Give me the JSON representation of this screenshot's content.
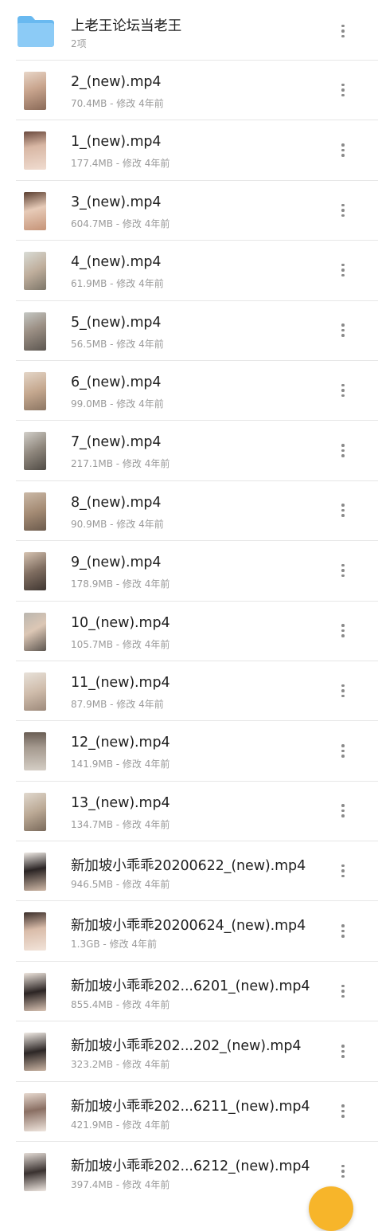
{
  "folder": {
    "name": "上老王论坛当老王",
    "count": "2项",
    "icon": "folder-icon",
    "color": "#5db4f2"
  },
  "files": [
    {
      "name": "2_(new).mp4",
      "meta": "70.4MB - 修改 4年前"
    },
    {
      "name": "1_(new).mp4",
      "meta": "177.4MB - 修改 4年前"
    },
    {
      "name": "3_(new).mp4",
      "meta": "604.7MB - 修改 4年前"
    },
    {
      "name": "4_(new).mp4",
      "meta": "61.9MB - 修改 4年前"
    },
    {
      "name": "5_(new).mp4",
      "meta": "56.5MB - 修改 4年前"
    },
    {
      "name": "6_(new).mp4",
      "meta": "99.0MB - 修改 4年前"
    },
    {
      "name": "7_(new).mp4",
      "meta": "217.1MB - 修改 4年前"
    },
    {
      "name": "8_(new).mp4",
      "meta": "90.9MB - 修改 4年前"
    },
    {
      "name": "9_(new).mp4",
      "meta": "178.9MB - 修改 4年前"
    },
    {
      "name": "10_(new).mp4",
      "meta": "105.7MB - 修改 4年前"
    },
    {
      "name": "11_(new).mp4",
      "meta": "87.9MB - 修改 4年前"
    },
    {
      "name": "12_(new).mp4",
      "meta": "141.9MB - 修改 4年前"
    },
    {
      "name": "13_(new).mp4",
      "meta": "134.7MB - 修改 4年前"
    },
    {
      "name": "新加坡小乖乖20200622_(new).mp4",
      "meta": "946.5MB - 修改 4年前"
    },
    {
      "name": "新加坡小乖乖20200624_(new).mp4",
      "meta": "1.3GB - 修改 4年前"
    },
    {
      "name": "新加坡小乖乖202...6201_(new).mp4",
      "meta": "855.4MB - 修改 4年前"
    },
    {
      "name": "新加坡小乖乖202...202_(new).mp4",
      "meta": "323.2MB - 修改 4年前"
    },
    {
      "name": "新加坡小乖乖202...6211_(new).mp4",
      "meta": "421.9MB - 修改 4年前"
    },
    {
      "name": "新加坡小乖乖202...6212_(new).mp4",
      "meta": "397.4MB - 修改 4年前"
    }
  ],
  "icons": {
    "more": "more-vertical-icon",
    "thumbnail": "video-thumbnail",
    "fab": "fab-button"
  },
  "colors": {
    "divider": "#e6e6e6",
    "meta_text": "#9a9a9a",
    "title_text": "#1f1f1f",
    "fab": "#f7b52a"
  }
}
